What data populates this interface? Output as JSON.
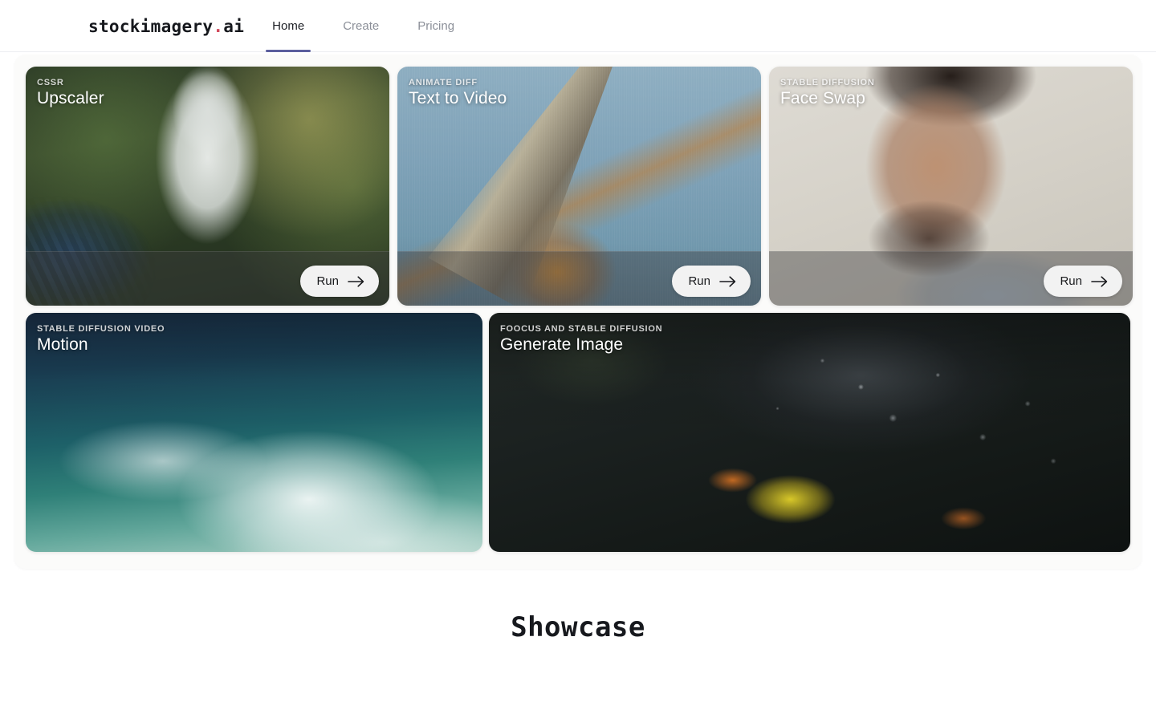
{
  "nav": {
    "logo": {
      "name": "stockimagery",
      "dot": ".",
      "tld": "ai"
    },
    "links": [
      {
        "label": "Home",
        "active": true
      },
      {
        "label": "Create",
        "active": false
      },
      {
        "label": "Pricing",
        "active": false
      }
    ]
  },
  "cards": [
    {
      "eyebrow": "CSSR",
      "title": "Upscaler",
      "action": "Run",
      "image_alt": "astronaut standing in a greenhouse with solar panels"
    },
    {
      "eyebrow": "ANIMATE DIFF",
      "title": "Text to Video",
      "action": "Run",
      "image_alt": "rocket powered aircraft climbing against a blue sky with flame"
    },
    {
      "eyebrow": "STABLE DIFFUSION",
      "title": "Face Swap",
      "action": "Run",
      "image_alt": "close up portrait of a bearded man in a striped shirt"
    },
    {
      "eyebrow": "STABLE DIFFUSION VIDEO",
      "title": "Motion",
      "image_alt": "breaking ocean wave with white sea foam"
    },
    {
      "eyebrow": "FOOCUS AND STABLE DIFFUSION",
      "title": "Generate Image",
      "image_alt": "dark gloved hands with water droplets over a yellow flower"
    }
  ],
  "showcase": {
    "heading": "Showcase"
  },
  "colors": {
    "accent_underline": "#5b5f9e",
    "logo_dot": "#d24a5c",
    "nav_active_text": "#1d1f25",
    "nav_inactive_text": "#8b8f98",
    "panel_bg": "#fbfbfa",
    "page_bg": "#ffffff",
    "run_button_bg": "#f2f2f2"
  }
}
